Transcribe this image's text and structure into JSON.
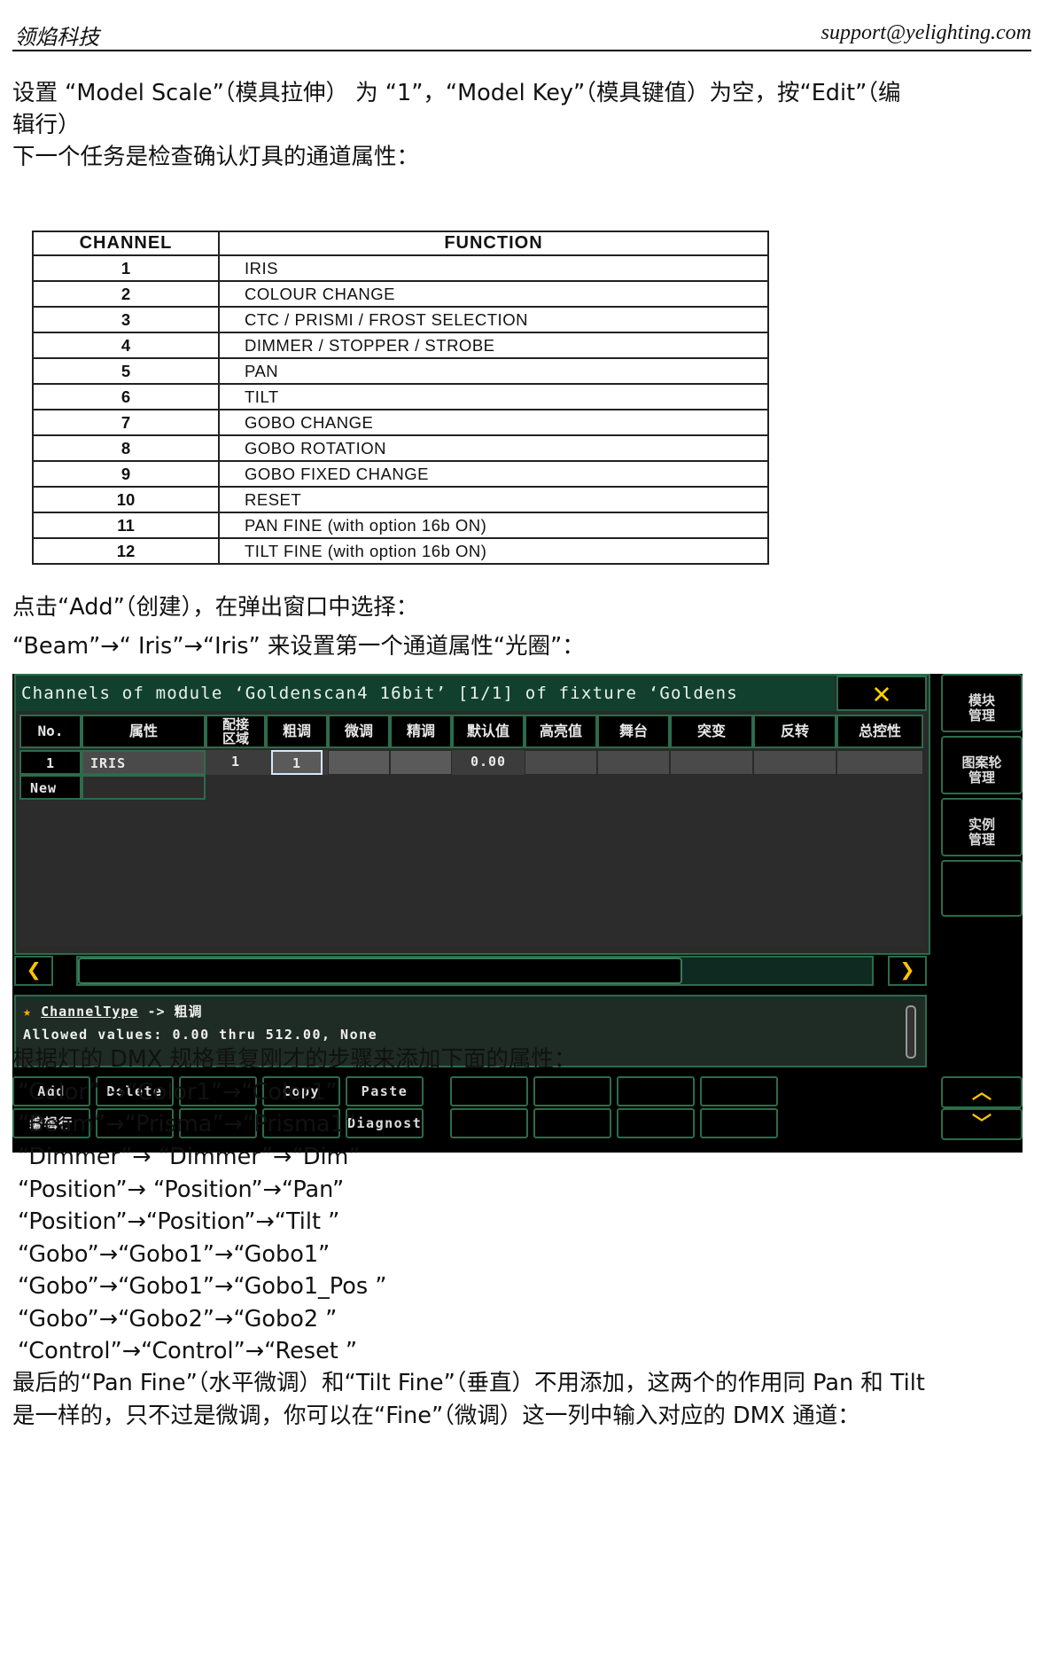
{
  "header": {
    "left": "领焰科技",
    "right": "support@yelighting.com"
  },
  "paragraphs": {
    "p1": "设置 “Model Scale”（模具拉伸） 为 “1”，“Model Key”（模具键值）为空，按“Edit”（编",
    "p2": "辑行）",
    "p3": "下一个任务是检查确认灯具的通道属性：",
    "p4": "点击“Add”（创建），在弹出窗口中选择：",
    "p5": "“Beam”→“ Iris”→“Iris” 来设置第一个通道属性“光圈”：",
    "p6": "根据灯的 DMX 规格重复刚才的步骤来添加下面的属性：",
    "l1": "“Color” →“Color1”→“Color1”",
    "l2": "“Beam”→“Prisma”→“Prisma1”",
    "l3": "“Dimmer”→ “Dimmer”→“Dim”",
    "l4": "“Position”→ “Position”→“Pan”",
    "l5": "“Position”→“Position”→“Tilt ”",
    "l6": "“Gobo”→“Gobo1”→“Gobo1”",
    "l7": "“Gobo”→“Gobo1”→“Gobo1_Pos ”",
    "l8": "“Gobo”→“Gobo2”→“Gobo2 ”",
    "l9": "“Control”→“Control”→“Reset ”",
    "p7": "最后的“Pan Fine”（水平微调）和“Tilt Fine”（垂直）不用添加，这两个的作用同 Pan 和 Tilt",
    "p8": "是一样的，只不过是微调，你可以在“Fine”（微调）这一列中输入对应的 DMX 通道："
  },
  "spec_table": {
    "headers": [
      "CHANNEL",
      "FUNCTION"
    ],
    "rows": [
      [
        "1",
        "IRIS"
      ],
      [
        "2",
        "COLOUR CHANGE"
      ],
      [
        "3",
        "CTC / PRISMI / FROST SELECTION"
      ],
      [
        "4",
        "DIMMER / STOPPER / STROBE"
      ],
      [
        "5",
        "PAN"
      ],
      [
        "6",
        "TILT"
      ],
      [
        "7",
        "GOBO CHANGE"
      ],
      [
        "8",
        "GOBO ROTATION"
      ],
      [
        "9",
        "GOBO FIXED CHANGE"
      ],
      [
        "10",
        "RESET"
      ],
      [
        "11",
        "PAN FINE (with option 16b ON)"
      ],
      [
        "12",
        "TILT FINE (with option 16b ON)"
      ]
    ]
  },
  "console": {
    "title": "Channels of module ‘Goldenscan4 16bit’ [1/1] of fixture ‘Goldens",
    "close_icon": "close-x-icon",
    "columns": [
      "No.",
      "属性",
      "配接\n区域",
      "粗调",
      "微调",
      "精调",
      "默认值",
      "高亮值",
      "舞台",
      "突变",
      "反转",
      "总控性"
    ],
    "row1": {
      "no": "1",
      "attr": "IRIS",
      "zone": "1",
      "coarse": "1",
      "default": "0.00"
    },
    "new_row": "New",
    "info_type_label": "ChannelType",
    "info_type_value": "-> 粗调",
    "info_allowed": "Allowed values: 0.00 thru 512.00, None",
    "buttons_row1": [
      "Add",
      "Delete",
      "",
      "Copy",
      "Paste",
      "",
      "",
      "",
      ""
    ],
    "buttons_row2": [
      "编辑行",
      "",
      "",
      "",
      "Diagnosti",
      "",
      "",
      "",
      ""
    ],
    "side": [
      "模块\n管理",
      "图案轮\n管理",
      "实例\n管理"
    ],
    "scroll_left_icon": "chevron-left-icon",
    "scroll_right_icon": "chevron-right-icon",
    "up_icon": "chevron-up-icon",
    "down_icon": "chevron-down-icon",
    "accent_color": "#ffc400",
    "border_color": "#2d6b4a"
  }
}
